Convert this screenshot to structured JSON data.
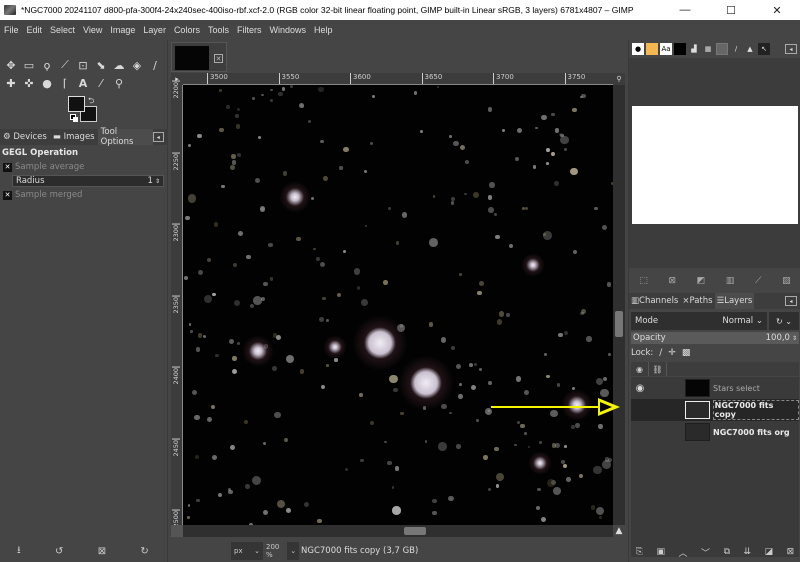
{
  "window": {
    "title": "*NGC7000 20241107 d800-pfa-300f4-24x240sec-400iso-rbf.xcf-2.0 (RGB color 32-bit linear floating point, GIMP built-in Linear sRGB, 3 layers) 6781x4807 – GIMP",
    "controls": {
      "minimize": "—",
      "maximize": "☐",
      "close": "✕"
    }
  },
  "menubar": [
    "File",
    "Edit",
    "Select",
    "View",
    "Image",
    "Layer",
    "Colors",
    "Tools",
    "Filters",
    "Windows",
    "Help"
  ],
  "toolbox": {
    "row1": [
      "move-tool",
      "rect-select-tool",
      "free-select-tool",
      "fuzzy-select-tool",
      "crop-tool",
      "unified-transform-tool",
      "warp-transform-tool",
      "bucket-fill-tool",
      "paintbrush-tool"
    ],
    "row2": [
      "heal-tool",
      "smudge-tool",
      "dodge-burn-tool",
      "paths-tool",
      "text-tool",
      "color-picker-tool",
      "zoom-tool"
    ],
    "foreground_color": "#111111",
    "background_color": "#111111"
  },
  "left_dock": {
    "tabs": [
      {
        "label": "Devices",
        "active": false
      },
      {
        "label": "Images",
        "active": false
      },
      {
        "label": "Tool Options",
        "active": true
      }
    ],
    "tool_options": {
      "heading": "GEGL Operation",
      "sample_average_label": "Sample average",
      "sample_average_checked": true,
      "radius_label": "Radius",
      "radius_value": "1",
      "sample_merged_label": "Sample merged",
      "sample_merged_checked": true
    },
    "bottom_buttons": [
      "save-preset-icon",
      "restore-icon",
      "delete-icon",
      "reset-icon"
    ]
  },
  "canvas": {
    "hruler_labels": [
      "3500",
      "3550",
      "3600",
      "3650",
      "3700",
      "3750"
    ],
    "vruler_labels": [
      "2200",
      "2250",
      "2300",
      "2350",
      "2400",
      "2450",
      "2500"
    ],
    "unit": "px",
    "zoom": "200 %",
    "status": "NGC7000 fits copy (3,7 GB)"
  },
  "right_dock": {
    "top_tabs": [
      "brushes",
      "patterns",
      "fonts",
      "colors",
      "histogram",
      "palettes",
      "gradient",
      "paint-dynamics",
      "tool-presets",
      "pointer"
    ],
    "layers_tabs": [
      {
        "label": "Channels",
        "active": false
      },
      {
        "label": "Paths",
        "active": false
      },
      {
        "label": "Layers",
        "active": true
      }
    ],
    "mode_label": "Mode",
    "mode_value": "Normal",
    "opacity_label": "Opacity",
    "opacity_value": "100,0",
    "lock_label": "Lock:",
    "layers": [
      {
        "name": "Stars select",
        "visible": true,
        "selected": false,
        "bold": false
      },
      {
        "name": "NGC7000 fits copy",
        "visible": false,
        "selected": true,
        "bold": true
      },
      {
        "name": "NGC7000 fits org",
        "visible": false,
        "selected": false,
        "bold": true
      }
    ]
  },
  "annotation": {
    "color": "#f5f500"
  }
}
